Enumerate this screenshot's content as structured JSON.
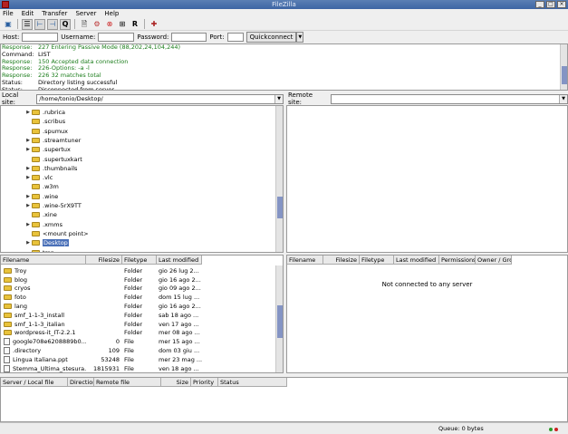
{
  "window": {
    "title": "FileZilla"
  },
  "menu": [
    "File",
    "Edit",
    "Transfer",
    "Server",
    "Help"
  ],
  "quickconnect": {
    "host_label": "Host:",
    "host_value": "",
    "user_label": "Username:",
    "user_value": "",
    "pass_label": "Password:",
    "pass_value": "",
    "port_label": "Port:",
    "port_value": "",
    "button": "Quickconnect"
  },
  "log": [
    {
      "label": "Response:",
      "text": "227 Entering Passive Mode (88,202,24,104,244)",
      "type": "resp"
    },
    {
      "label": "Command:",
      "text": "LIST",
      "type": "cmd"
    },
    {
      "label": "Response:",
      "text": "150 Accepted data connection",
      "type": "resp"
    },
    {
      "label": "Response:",
      "text": "226-Options: -a -l",
      "type": "resp"
    },
    {
      "label": "Response:",
      "text": "226 32 matches total",
      "type": "resp"
    },
    {
      "label": "Status:",
      "text": "Directory listing successful",
      "type": "status"
    },
    {
      "label": "Status:",
      "text": "Disconnected from server",
      "type": "status"
    }
  ],
  "local_site": {
    "label": "Local site:",
    "path": "/home/tonio/Desktop/"
  },
  "remote_site": {
    "label": "Remote site:",
    "path": ""
  },
  "tree": [
    {
      "name": ".rubrica",
      "expandable": true
    },
    {
      "name": ".scribus",
      "expandable": false
    },
    {
      "name": ".spumux",
      "expandable": false
    },
    {
      "name": ".streamtuner",
      "expandable": true
    },
    {
      "name": ".supertux",
      "expandable": true
    },
    {
      "name": ".supertuxkart",
      "expandable": false
    },
    {
      "name": ".thumbnails",
      "expandable": true
    },
    {
      "name": ".vlc",
      "expandable": true
    },
    {
      "name": ".w3m",
      "expandable": false
    },
    {
      "name": ".wine",
      "expandable": true
    },
    {
      "name": ".wine-5rX9TT",
      "expandable": true
    },
    {
      "name": ".xine",
      "expandable": false
    },
    {
      "name": ".xmms",
      "expandable": true
    },
    {
      "name": "<mount point>",
      "expandable": false
    },
    {
      "name": "Desktop",
      "expandable": true,
      "selected": true
    },
    {
      "name": "tmp",
      "expandable": false
    }
  ],
  "local_columns": [
    "Filename",
    "Filesize",
    "Filetype",
    "Last modified"
  ],
  "local_files": [
    {
      "name": "Troy",
      "size": "",
      "type": "Folder",
      "modified": "gio 26 lug 2...",
      "kind": "folder"
    },
    {
      "name": "blog",
      "size": "",
      "type": "Folder",
      "modified": "gio 16 ago 2...",
      "kind": "folder"
    },
    {
      "name": "cryos",
      "size": "",
      "type": "Folder",
      "modified": "gio 09 ago 2...",
      "kind": "folder"
    },
    {
      "name": "foto",
      "size": "",
      "type": "Folder",
      "modified": "dom 15 lug ...",
      "kind": "folder"
    },
    {
      "name": "lang",
      "size": "",
      "type": "Folder",
      "modified": "gio 16 ago 2...",
      "kind": "folder"
    },
    {
      "name": "smf_1-1-3_install",
      "size": "",
      "type": "Folder",
      "modified": "sab 18 ago ...",
      "kind": "folder"
    },
    {
      "name": "smf_1-1-3_italian",
      "size": "",
      "type": "Folder",
      "modified": "ven 17 ago ...",
      "kind": "folder"
    },
    {
      "name": "wordpress-it_IT-2.2.1",
      "size": "",
      "type": "Folder",
      "modified": "mer 08 ago ...",
      "kind": "folder"
    },
    {
      "name": "google708e6208889b0...",
      "size": "0",
      "type": "File",
      "modified": "mer 15 ago ...",
      "kind": "file"
    },
    {
      "name": ".directory",
      "size": "109",
      "type": "File",
      "modified": "dom 03 giu ...",
      "kind": "file"
    },
    {
      "name": "Lingua Italiana.ppt",
      "size": "53248",
      "type": "File",
      "modified": "mer 23 mag ...",
      "kind": "file"
    },
    {
      "name": "Stemma_Ultima_stesura...",
      "size": "1815931",
      "type": "File",
      "modified": "ven 18 ago ...",
      "kind": "file"
    }
  ],
  "remote_columns": [
    "Filename",
    "Filesize",
    "Filetype",
    "Last modified",
    "Permissions",
    "Owner / Gro"
  ],
  "remote_message": "Not connected to any server",
  "queue_columns": [
    "Server / Local file",
    "Direction",
    "Remote file",
    "Size",
    "Priority",
    "Status"
  ],
  "status": {
    "queue": "Queue: 0 bytes"
  },
  "colors": {
    "response": "#1a7c1a",
    "selection": "#4a70b8",
    "folder": "#e9c33b"
  }
}
